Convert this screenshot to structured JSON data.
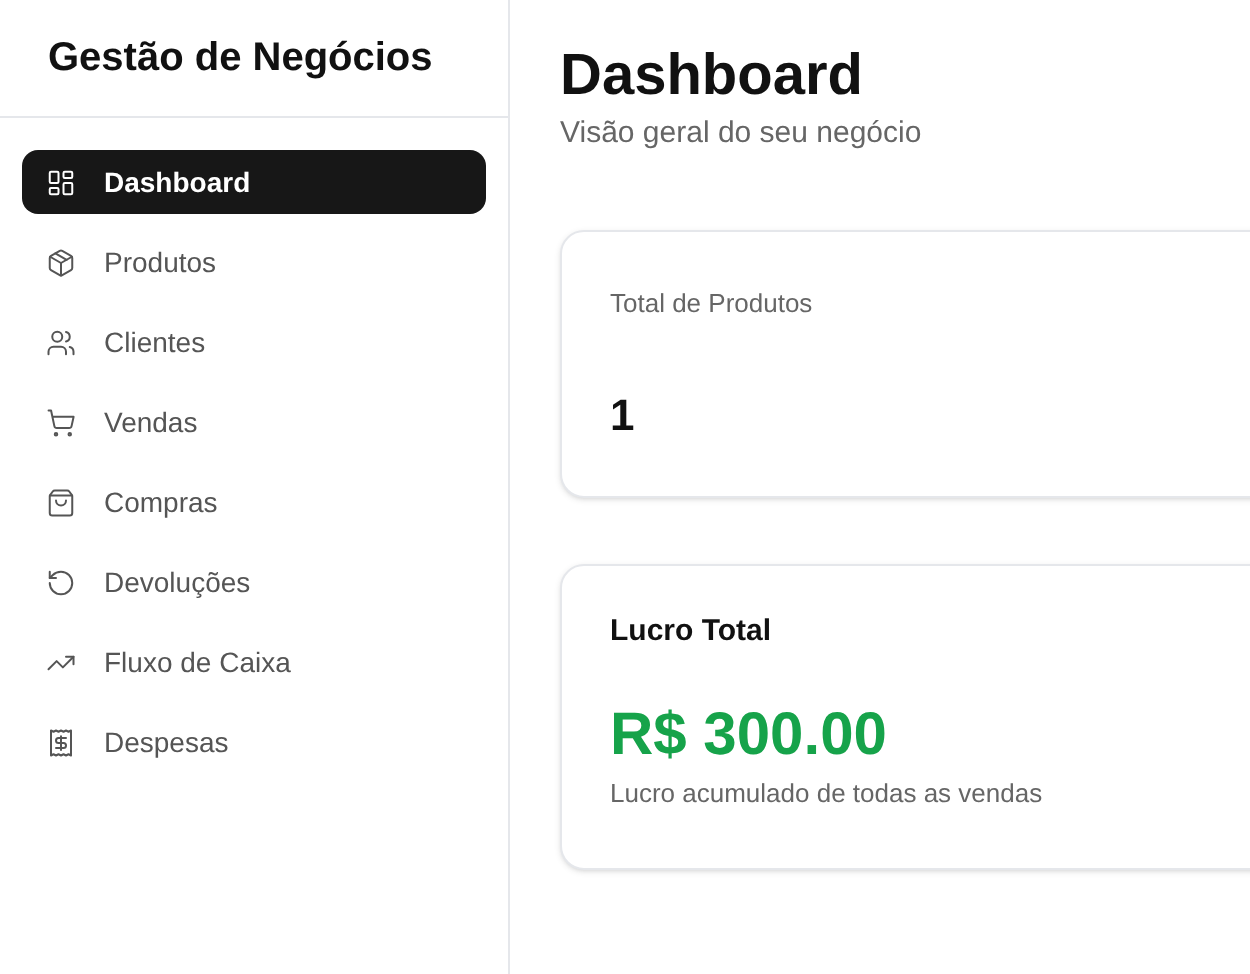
{
  "sidebar": {
    "title": "Gestão de Negócios",
    "items": [
      {
        "label": "Dashboard",
        "selected": true
      },
      {
        "label": "Produtos",
        "selected": false
      },
      {
        "label": "Clientes",
        "selected": false
      },
      {
        "label": "Vendas",
        "selected": false
      },
      {
        "label": "Compras",
        "selected": false
      },
      {
        "label": "Devoluções",
        "selected": false
      },
      {
        "label": "Fluxo de Caixa",
        "selected": false
      },
      {
        "label": "Despesas",
        "selected": false
      }
    ]
  },
  "header": {
    "title": "Dashboard",
    "subtitle": "Visão geral do seu negócio"
  },
  "cards": [
    {
      "kind": "count",
      "title": "Total de Produtos",
      "value": "1"
    },
    {
      "kind": "profit",
      "title": "Lucro Total",
      "value": "R$ 300.00",
      "note": "Lucro acumulado de todas as vendas"
    }
  ]
}
